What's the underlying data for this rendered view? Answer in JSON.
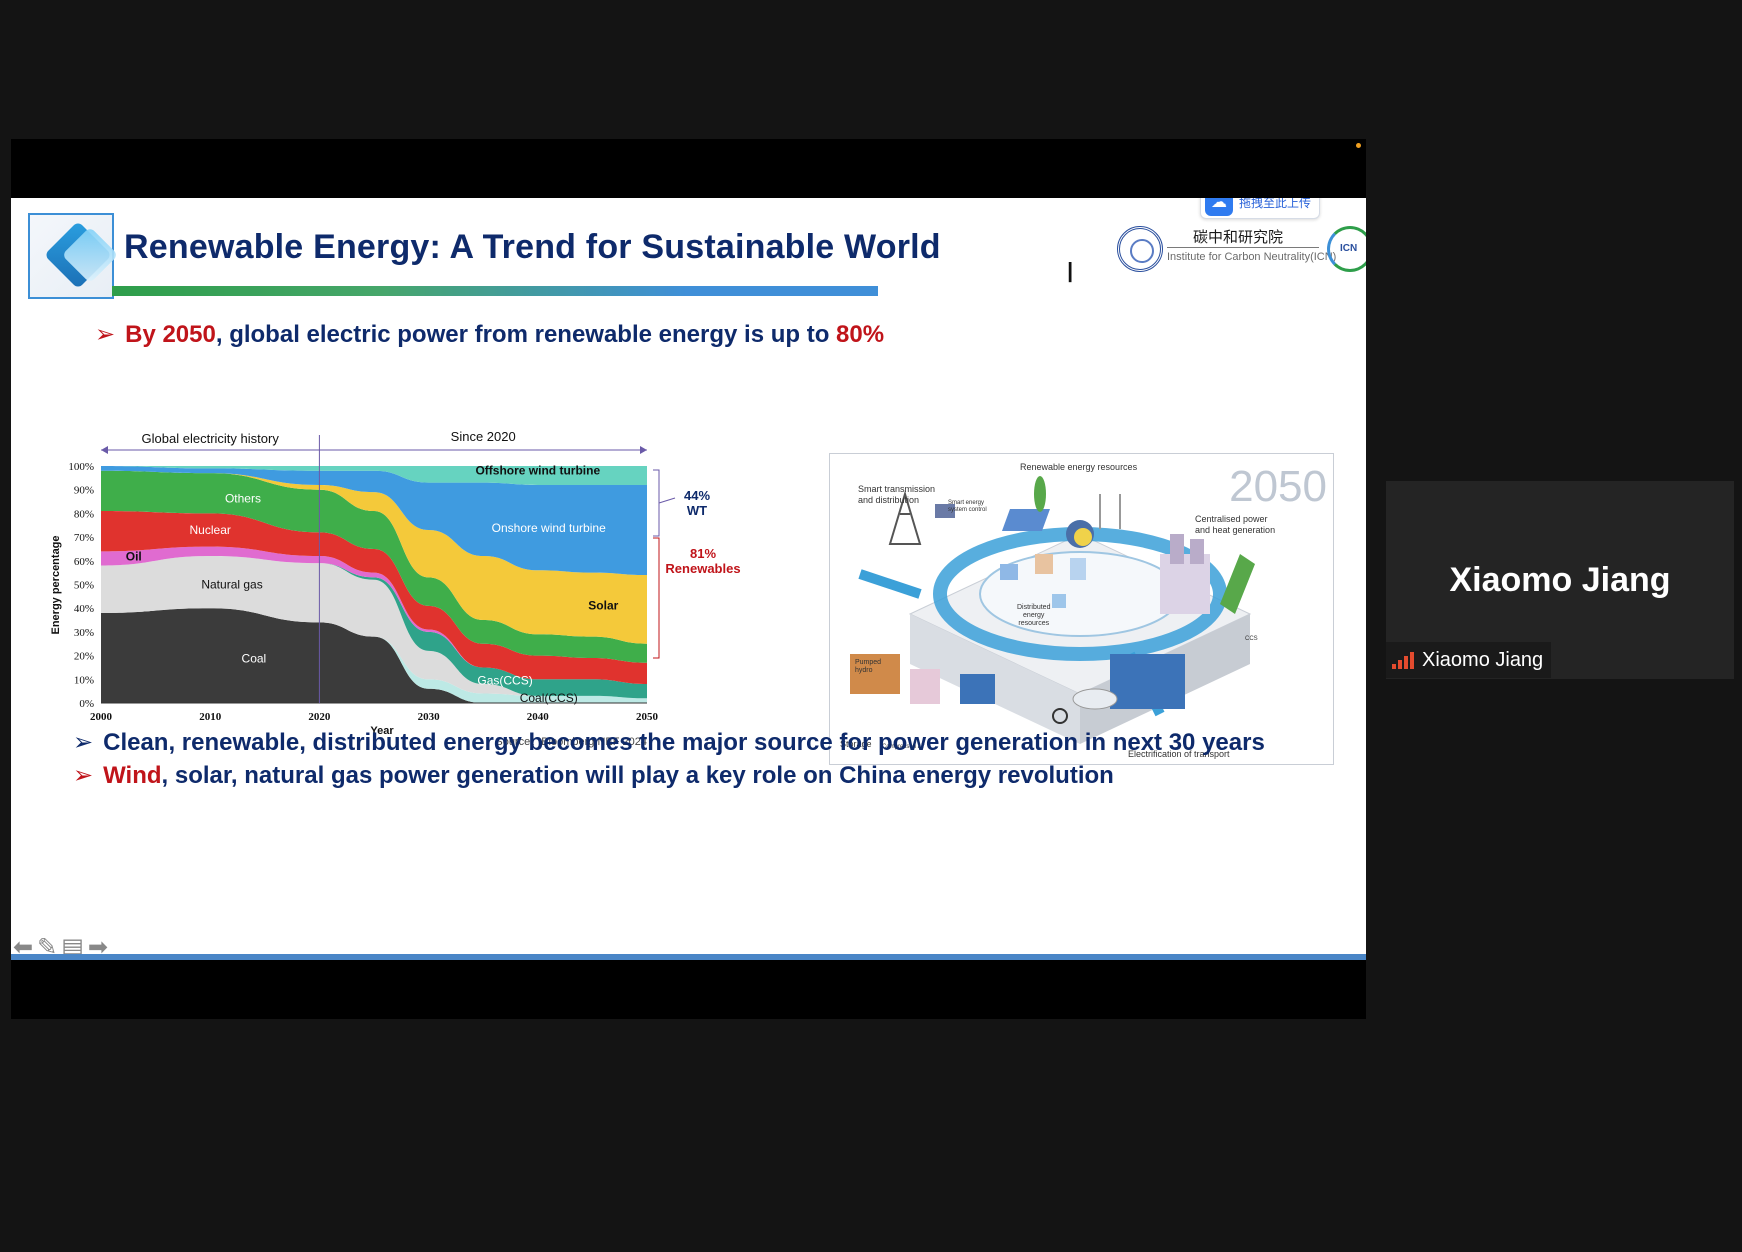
{
  "slide": {
    "title": "Renewable Energy: A Trend for Sustainable World",
    "upload_badge": "拖拽至此上传",
    "org_cn": "碳中和研究院",
    "org_en": "Institute for Carbon Neutrality(ICN)",
    "org_logo_text": "ICN",
    "bullet1": {
      "arrow": "➢",
      "pre": "By 2050",
      "mid": ", global electric power from renewable energy is up to ",
      "post": "80%"
    },
    "bullet2": {
      "arrow": "➢",
      "text": "Clean, renewable, distributed energy becomes the major source for power generation in next 30 years"
    },
    "bullet3": {
      "arrow": "➢",
      "pre": "Wind",
      "text": ", solar, natural gas power generation will play a key role on China energy revolution"
    }
  },
  "chart_data": {
    "type": "area",
    "stacked": true,
    "header_left": "Global electricity history",
    "header_right": "Since 2020",
    "ylabel": "Energy percentage",
    "xlabel": "Year",
    "source": "Source：Bloomberg NEF 2024",
    "x_ticks": [
      "2000",
      "2010",
      "2020",
      "2030",
      "2040",
      "2050"
    ],
    "y_ticks": [
      "0%",
      "10%",
      "20%",
      "30%",
      "40%",
      "50%",
      "60%",
      "70%",
      "80%",
      "90%",
      "100%"
    ],
    "ylim": [
      0,
      100
    ],
    "x": [
      2000,
      2010,
      2020,
      2025,
      2030,
      2035,
      2040,
      2045,
      2050
    ],
    "series": [
      {
        "name": "Coal",
        "color": "#3b3b3b",
        "values": [
          38,
          40,
          34,
          28,
          6,
          0,
          0,
          0,
          0
        ]
      },
      {
        "name": "Coal(CCS)",
        "color": "#bde9e5",
        "values": [
          0,
          0,
          0,
          0,
          4,
          4,
          3,
          3,
          2
        ]
      },
      {
        "name": "Natural gas",
        "color": "#dcdcdc",
        "values": [
          20,
          22,
          25,
          24,
          12,
          4,
          0,
          0,
          0
        ]
      },
      {
        "name": "Gas(CCS)",
        "color": "#2fa38a",
        "values": [
          0,
          0,
          0,
          1,
          8,
          7,
          7,
          7,
          6
        ]
      },
      {
        "name": "Oil",
        "color": "#e06bd0",
        "values": [
          6,
          4,
          3,
          2,
          1,
          0,
          0,
          0,
          0
        ]
      },
      {
        "name": "Nuclear",
        "color": "#e0332e",
        "values": [
          17,
          14,
          10,
          10,
          10,
          10,
          10,
          9,
          9
        ]
      },
      {
        "name": "Others",
        "color": "#3fae4a",
        "values": [
          17,
          17,
          18,
          16,
          12,
          10,
          9,
          9,
          8
        ]
      },
      {
        "name": "Solar",
        "color": "#f4c93a",
        "values": [
          0,
          0,
          2,
          8,
          20,
          27,
          27,
          27,
          29
        ]
      },
      {
        "name": "Onshore wind turbine",
        "color": "#3f9be0",
        "values": [
          2,
          2,
          6,
          9,
          20,
          31,
          36,
          37,
          38
        ]
      },
      {
        "name": "Offshore wind turbine",
        "color": "#66d3c0",
        "values": [
          0,
          1,
          2,
          2,
          7,
          7,
          8,
          8,
          8
        ]
      }
    ],
    "annotations": {
      "wt_pct": "44%",
      "wt_label": "WT",
      "ren_pct": "81%",
      "ren_label": "Renewables"
    }
  },
  "illustration": {
    "year": "2050",
    "labels": {
      "resources": "Renewable energy resources",
      "smart_transmission_1": "Smart transmission",
      "smart_transmission_2": "and distribution",
      "smart_control_1": "Smart energy",
      "smart_control_2": "system control",
      "centralised_1": "Centralised power",
      "centralised_2": "and heat generation",
      "distributed_1": "Distributed",
      "distributed_2": "energy",
      "distributed_3": "resources",
      "pumped_1": "Pumped",
      "pumped_2": "hydro",
      "storage": "Storage",
      "compressed": "Compressed air",
      "ccs": "CCS",
      "transport": "Electrification of transport"
    }
  },
  "participant": {
    "name_big": "Xiaomo Jiang",
    "name_label": "Xiaomo Jiang"
  }
}
